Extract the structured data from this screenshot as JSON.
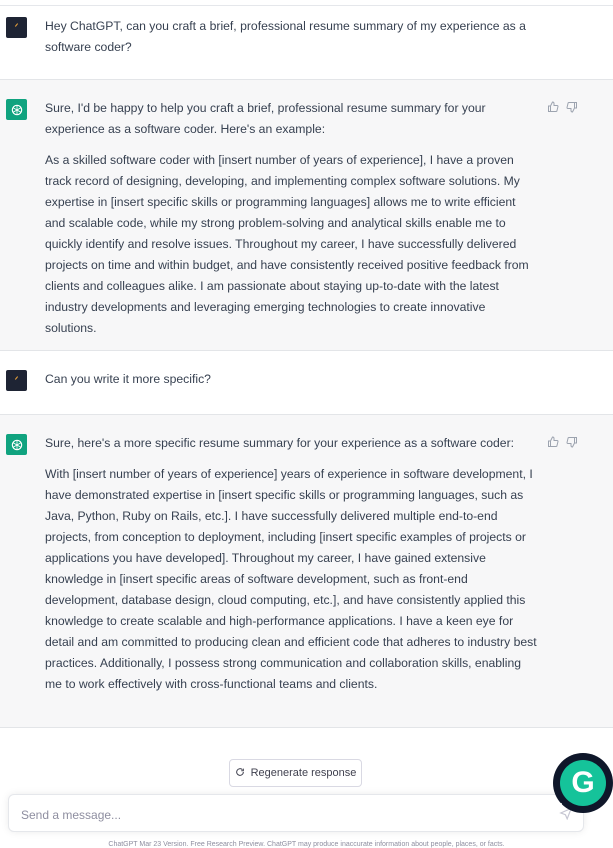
{
  "conversation": {
    "user_msg_1": "Hey ChatGPT, can you craft a brief, professional resume summary of my experience as a software coder?",
    "bot_msg_1_intro": "Sure, I'd be happy to help you craft a brief, professional resume summary for your experience as a software coder. Here's an example:",
    "bot_msg_1_body": "As a skilled software coder with [insert number of years of experience], I have a proven track record of designing, developing, and implementing complex software solutions. My expertise in [insert specific skills or programming languages] allows me to write efficient and scalable code, while my strong problem-solving and analytical skills enable me to quickly identify and resolve issues. Throughout my career, I have successfully delivered projects on time and within budget, and have consistently received positive feedback from clients and colleagues alike. I am passionate about staying up-to-date with the latest industry developments and leveraging emerging technologies to create innovative solutions.",
    "user_msg_2": "Can you write it more specific?",
    "bot_msg_2_intro": "Sure, here's a more specific resume summary for your experience as a software coder:",
    "bot_msg_2_body": "With [insert number of years of experience] years of experience in software development, I have demonstrated expertise in [insert specific skills or programming languages, such as Java, Python, Ruby on Rails, etc.]. I have successfully delivered multiple end-to-end projects, from conception to deployment, including [insert specific examples of projects or applications you have developed]. Throughout my career, I have gained extensive knowledge in [insert specific areas of software development, such as front-end development, database design, cloud computing, etc.], and have consistently applied this knowledge to create scalable and high-performance applications. I have a keen eye for detail and am committed to producing clean and efficient code that adheres to industry best practices. Additionally, I possess strong communication and collaboration skills, enabling me to work effectively with cross-functional teams and clients."
  },
  "controls": {
    "regenerate_label": "Regenerate response",
    "input_placeholder": "Send a message..."
  },
  "footer": {
    "text": "ChatGPT Mar 23 Version. Free Research Preview. ChatGPT may produce inaccurate information about people, places, or facts."
  },
  "grammarly": {
    "letter": "G"
  },
  "icons": [
    "user-avatar-icon",
    "openai-logo-icon",
    "thumbs-up-icon",
    "thumbs-down-icon",
    "refresh-icon",
    "send-icon",
    "grammarly-icon"
  ],
  "colors": {
    "assistant_bg": "#f7f7f8",
    "openai_green": "#10a37f",
    "grammarly_green": "#15c39a"
  }
}
